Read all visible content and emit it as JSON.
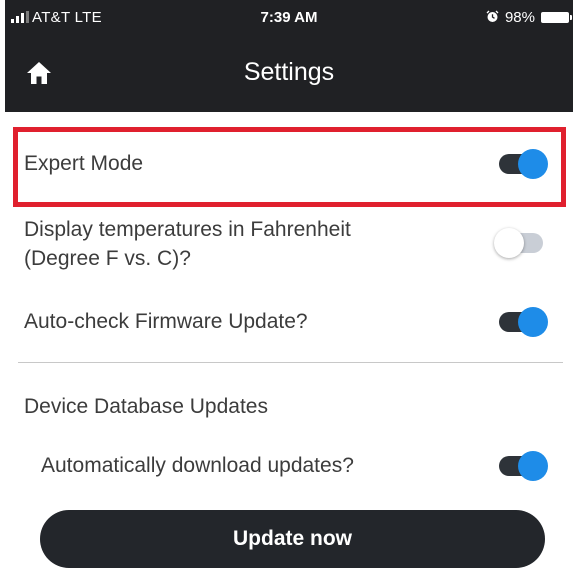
{
  "status_bar": {
    "carrier": "AT&T  LTE",
    "time": "7:39 AM",
    "battery": "98%"
  },
  "header": {
    "title": "Settings",
    "home_icon": "home-icon"
  },
  "settings": {
    "expert_mode": {
      "label": "Expert Mode",
      "enabled": true
    },
    "fahrenheit": {
      "line1": "Display temperatures in Fahrenheit",
      "line2": "(Degree F vs. C)?",
      "enabled": false
    },
    "auto_firmware": {
      "label": "Auto-check Firmware Update?",
      "enabled": true
    }
  },
  "database": {
    "section_title": "Device Database Updates",
    "auto_download": {
      "label": "Automatically download updates?",
      "enabled": true
    },
    "update_button": "Update now"
  },
  "colors": {
    "header_bg": "#202124",
    "toggle_on": "#1e8ce8",
    "highlight": "#e0202e",
    "button_bg": "#23262b"
  }
}
